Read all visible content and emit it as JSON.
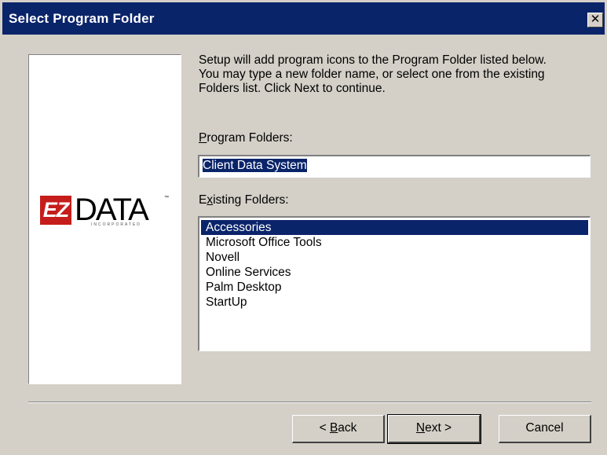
{
  "window": {
    "title": "Select Program Folder",
    "close_glyph": "✕",
    "close_icon": "close-icon"
  },
  "logo": {
    "ez": "EZ",
    "word": "DATA",
    "tm": "™",
    "tagline": "INCORPORATED"
  },
  "intro": {
    "line1": "Setup will add program icons to the Program Folder listed below.",
    "line2": "You may type a new folder name, or select one from the existing",
    "line3": "Folders list.  Click Next to continue."
  },
  "program_folders": {
    "label_mnemonic": "P",
    "label_rest": "rogram Folders:",
    "value": "Client Data System"
  },
  "existing_folders": {
    "label_pre": "E",
    "label_mnemonic": "x",
    "label_rest": "isting Folders:",
    "items": [
      {
        "label": "Accessories",
        "selected": true
      },
      {
        "label": "Microsoft Office Tools",
        "selected": false
      },
      {
        "label": "Novell",
        "selected": false
      },
      {
        "label": "Online Services",
        "selected": false
      },
      {
        "label": "Palm Desktop",
        "selected": false
      },
      {
        "label": "StartUp",
        "selected": false
      }
    ]
  },
  "buttons": {
    "back_pre": "< ",
    "back_mnemonic": "B",
    "back_rest": "ack",
    "next_mnemonic": "N",
    "next_rest": "ext >",
    "cancel": "Cancel"
  },
  "colors": {
    "titlebar": "#0a246a",
    "face": "#d4d0c8",
    "logo_red": "#c51d1b",
    "selection": "#0a246a"
  }
}
